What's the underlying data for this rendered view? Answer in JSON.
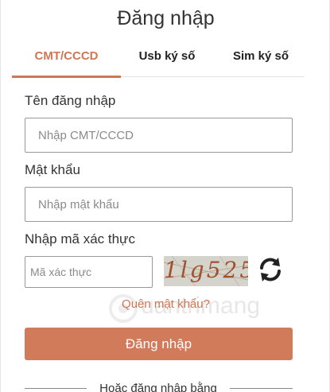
{
  "page": {
    "title": "Đăng nhập"
  },
  "tabs": [
    {
      "label": "CMT/CCCD",
      "active": true
    },
    {
      "label": "Usb ký số",
      "active": false
    },
    {
      "label": "Sim ký số",
      "active": false
    }
  ],
  "form": {
    "username_label": "Tên đăng nhập",
    "username_placeholder": "Nhập CMT/CCCD",
    "password_label": "Mật khẩu",
    "password_placeholder": "Nhập mật khẩu",
    "captcha_label": "Nhập mã xác thực",
    "captcha_placeholder": "Mã xác thực",
    "captcha_code": "1lg525",
    "refresh_icon": "refresh-icon",
    "forgot_password": "Quên mật khẩu?",
    "submit_label": "Đăng nhập",
    "or_login_with": "Hoặc đăng nhập bằng"
  },
  "watermark": {
    "text": "uantrimang"
  },
  "colors": {
    "accent": "#cf7754",
    "button": "#d17b5a",
    "text": "#333333",
    "border": "#999999"
  }
}
